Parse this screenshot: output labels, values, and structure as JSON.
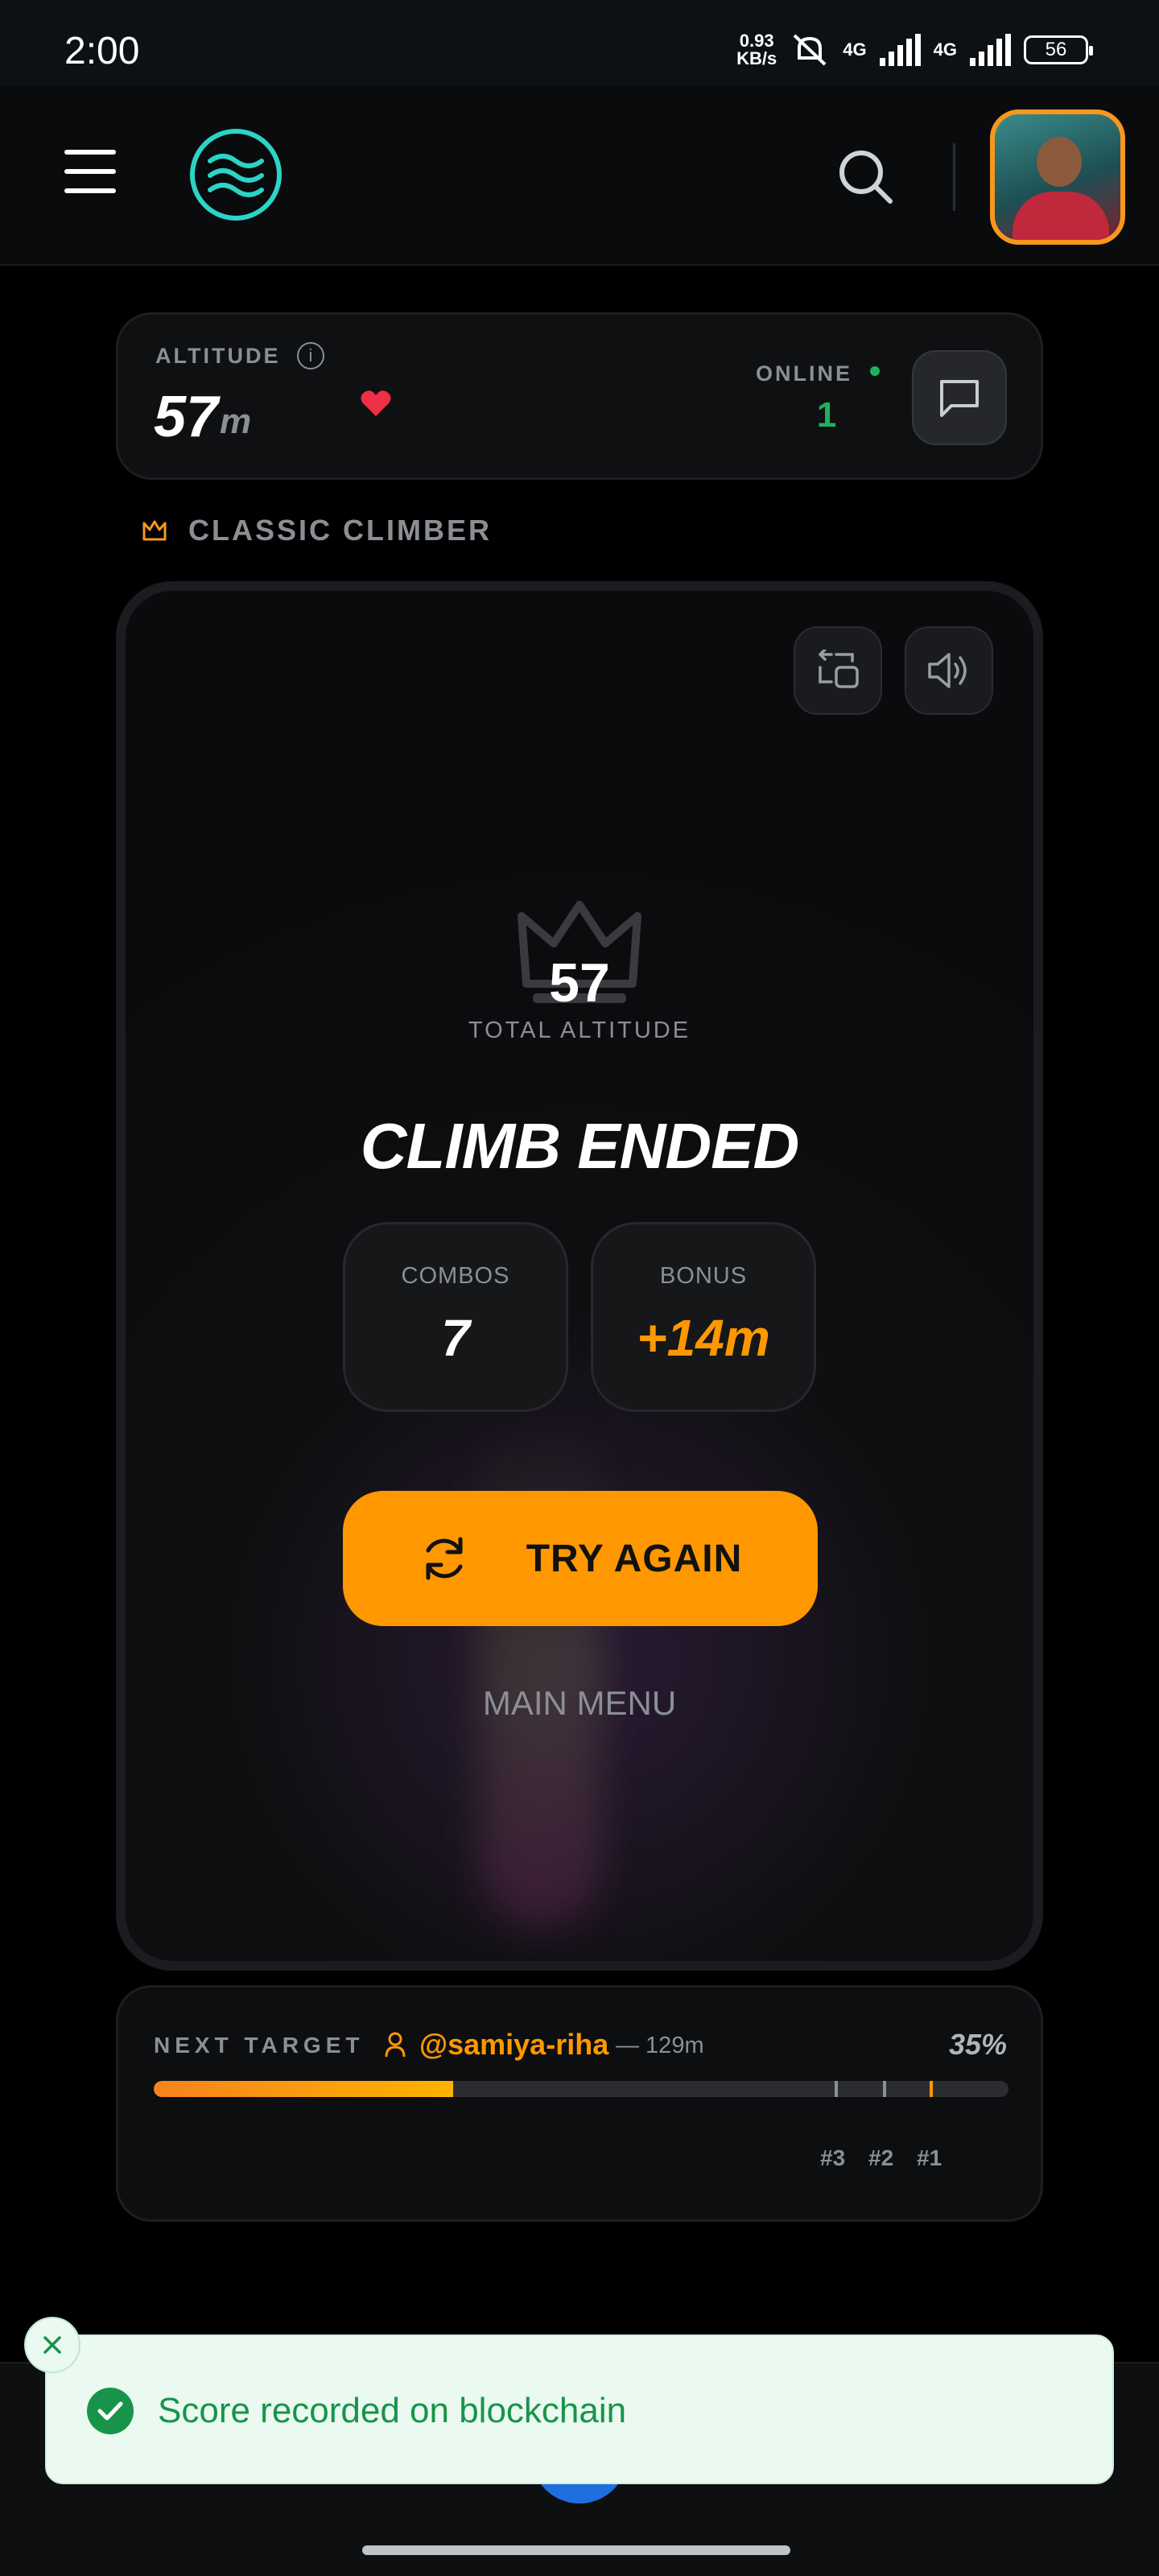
{
  "status_bar": {
    "time": "2:00",
    "net_speed": "0.93",
    "net_speed_unit": "KB/s",
    "net1": "4G",
    "net2": "4G",
    "battery": "56"
  },
  "header": {
    "menu_icon": "hamburger-menu-icon",
    "logo_icon": "waves-logo-icon",
    "search_icon": "search-icon",
    "avatar": "user-avatar"
  },
  "altitude_card": {
    "label": "ALTITUDE",
    "value": "57",
    "unit": "m",
    "online_label": "ONLINE",
    "online_count": "1"
  },
  "mode": {
    "label": "CLASSIC CLIMBER"
  },
  "game": {
    "total_value": "57",
    "total_label": "TOTAL ALTITUDE",
    "title": "CLIMB ENDED",
    "combos_label": "COMBOS",
    "combos_value": "7",
    "bonus_label": "BONUS",
    "bonus_value": "+14m",
    "try_again_label": "TRY AGAIN",
    "main_menu_label": "MAIN MENU"
  },
  "next_target": {
    "label": "NEXT TARGET",
    "user": "@samiya-riha",
    "distance": "— 129m",
    "percent_text": "35%",
    "progress": 0.35,
    "ranks": [
      "#3",
      "#2",
      "#1"
    ]
  },
  "toast": {
    "message": "Score recorded on blockchain"
  },
  "colors": {
    "accent": "#ff9800",
    "success": "#18944a",
    "online": "#1fb25a",
    "logo": "#2bd4c6"
  }
}
